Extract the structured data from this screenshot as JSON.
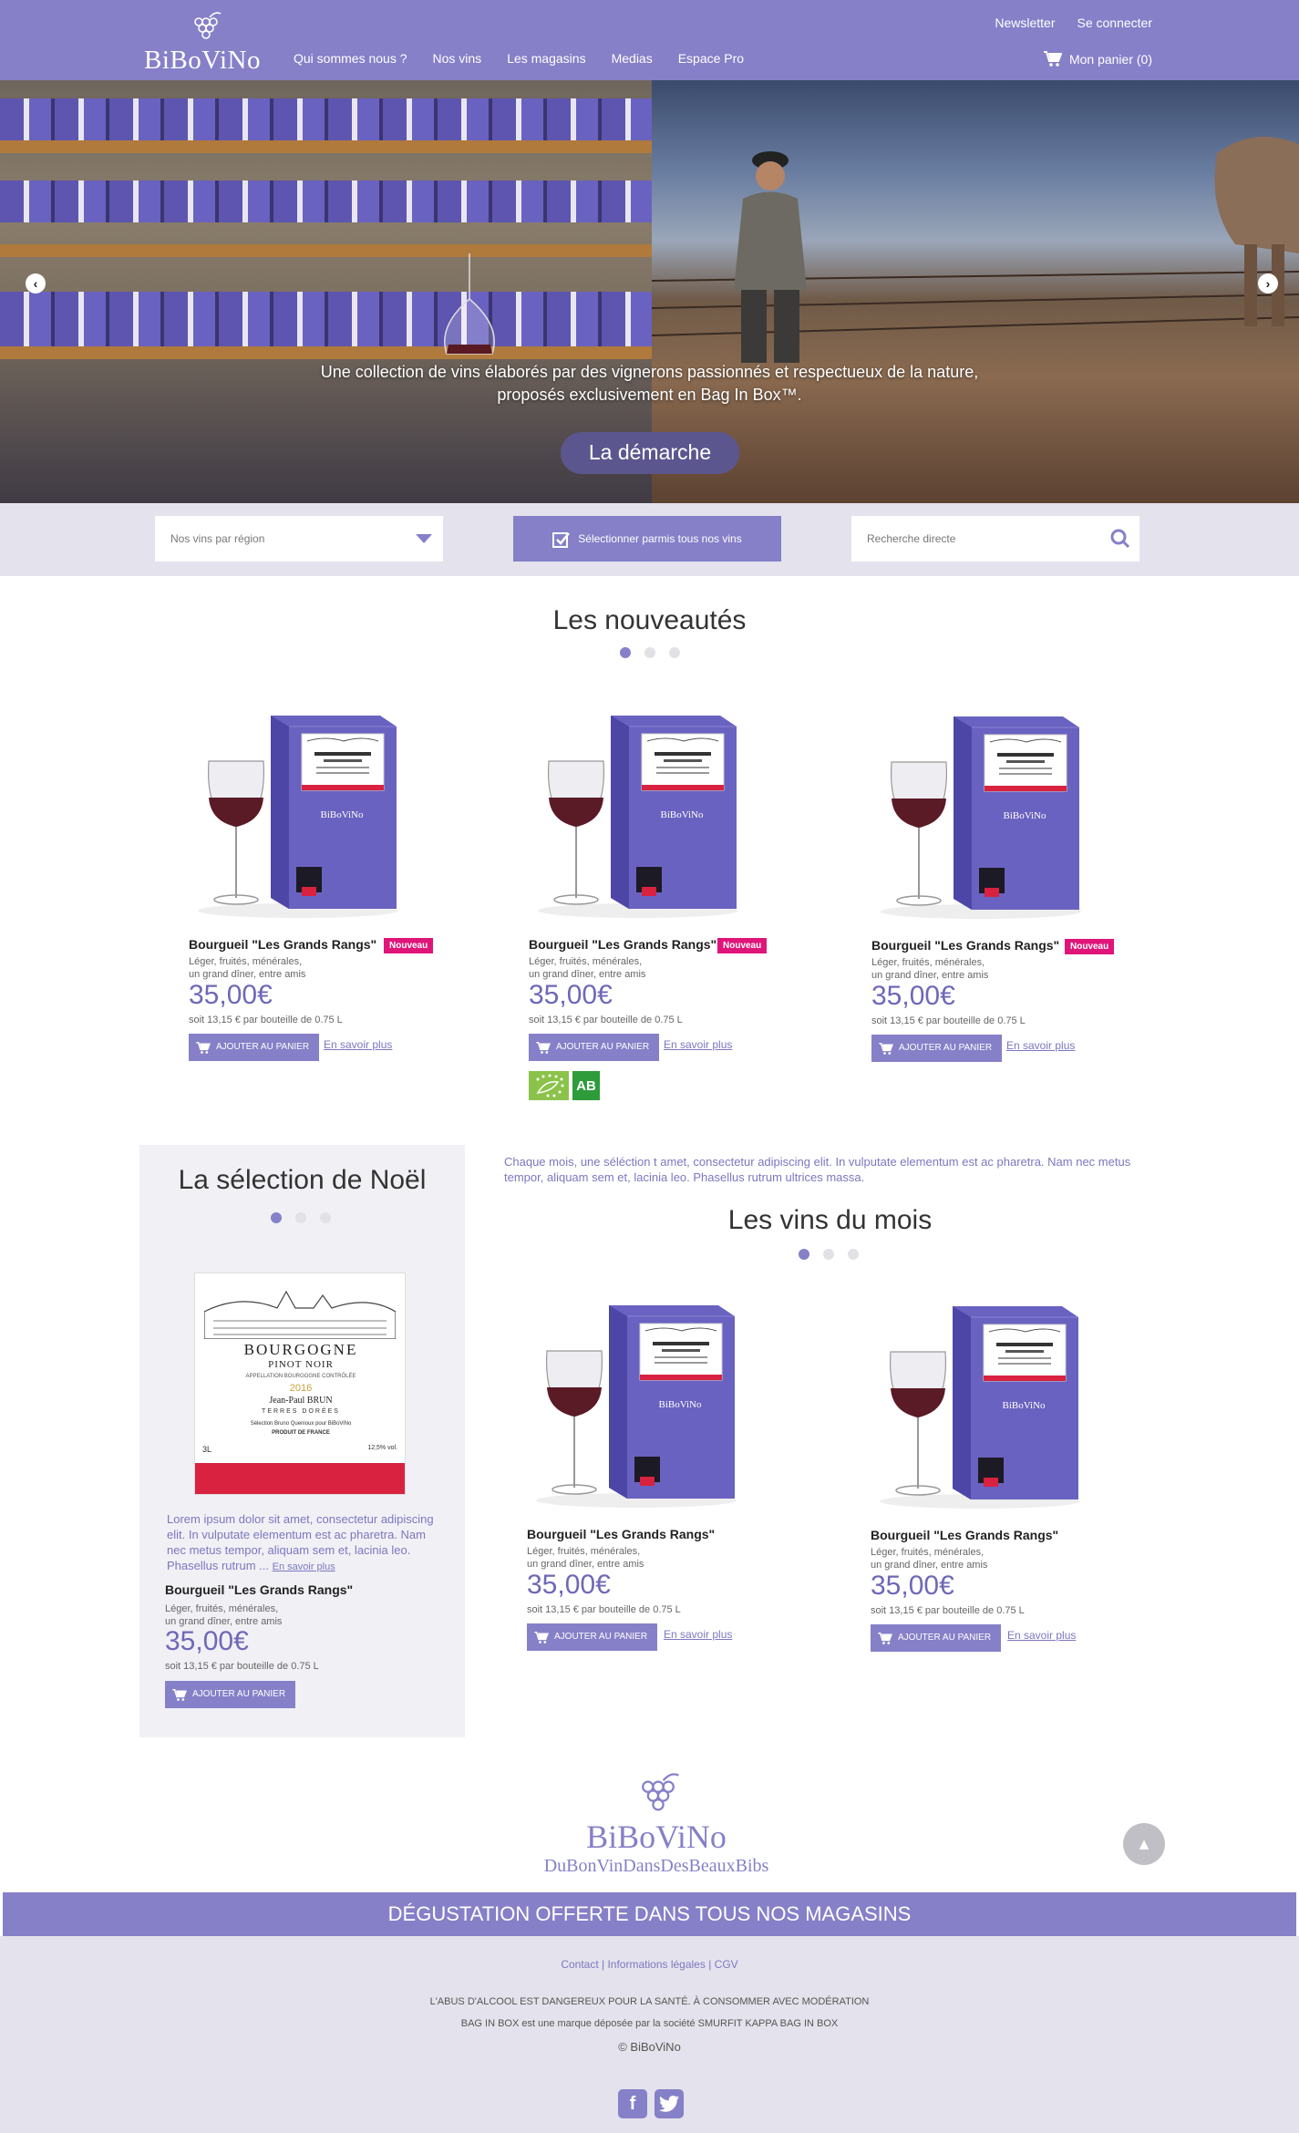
{
  "header": {
    "logo_text": "BiBoViNo",
    "nav": [
      "Qui sommes nous ?",
      "Nos vins",
      "Les magasins",
      "Medias",
      "Espace Pro"
    ],
    "newsletter": "Newsletter",
    "login": "Se connecter",
    "cart": "Mon panier (0)"
  },
  "hero": {
    "line1": "Une collection de vins élaborés par des vignerons passionnés et respectueux de la nature,",
    "line2": "proposés exclusivement en Bag In Box™.",
    "button": "La démarche"
  },
  "filters": {
    "region_placeholder": "Nos vins par région",
    "select_all": "Sélectionner parmis tous nos vins",
    "search_placeholder": "Recherche directe"
  },
  "nouveautes": {
    "title": "Les nouveautés",
    "products": [
      {
        "name": "Bourgueil \"Les Grands Rangs\"",
        "badge": "Nouveau",
        "desc1": "Léger, fruités, ménérales,",
        "desc2": "un grand dîner, entre amis",
        "price": "35,00€",
        "unit": "soit 13,15 € par bouteille de 0.75 L",
        "add": "AJOUTER AU PANIER",
        "more": "En savoir plus"
      },
      {
        "name": "Bourgueil \"Les Grands Rangs\"",
        "badge": "Nouveau",
        "desc1": "Léger, fruités, ménérales,",
        "desc2": "un grand dîner, entre amis",
        "price": "35,00€",
        "unit": "soit 13,15 € par bouteille de 0.75 L",
        "add": "AJOUTER AU PANIER",
        "more": "En savoir plus"
      },
      {
        "name": "Bourgueil \"Les Grands Rangs\"",
        "badge": "Nouveau",
        "desc1": "Léger, fruités, ménérales,",
        "desc2": "un grand dîner, entre amis",
        "price": "35,00€",
        "unit": "soit 13,15 € par bouteille de 0.75 L",
        "add": "AJOUTER AU PANIER",
        "more": "En savoir plus"
      }
    ],
    "bio_label": "AB"
  },
  "box_label": "BiBoViNo",
  "noel": {
    "title": "La sélection de Noël",
    "label": {
      "region": "BOURGOGNE",
      "type": "PINOT NOIR",
      "appellation": "APPELLATION BOURGOGNE CONTRÔLÉE",
      "year": "2016",
      "producer": "Jean-Paul BRUN",
      "domain": "TERRES DORÉES",
      "selection": "Sélection Bruno Quenioux pour BiBoViNo",
      "origin": "PRODUIT DE FRANCE",
      "volume": "3L",
      "alcohol": "12,5% vol."
    },
    "text": "Lorem ipsum dolor sit amet, consectetur adipiscing elit. In vulputate elementum est ac pharetra. Nam nec metus tempor, aliquam sem et, lacinia leo. Phasellus rutrum ...",
    "more": "En savoir plus",
    "product": {
      "name": "Bourgueil \"Les Grands Rangs\"",
      "desc1": "Léger, fruités, ménérales,",
      "desc2": "un grand dîner, entre amis",
      "price": "35,00€",
      "unit": "soit 13,15 € par bouteille de 0.75 L",
      "add": "AJOUTER AU PANIER"
    }
  },
  "mois": {
    "intro": "Chaque mois, une séléction t amet, consectetur adipiscing elit. In vulputate elementum est ac pharetra. Nam nec metus tempor, aliquam sem et, lacinia leo. Phasellus rutrum ultrices massa.",
    "title": "Les vins du mois",
    "products": [
      {
        "name": "Bourgueil \"Les Grands Rangs\"",
        "desc1": "Léger, fruités, ménérales,",
        "desc2": "un grand dîner, entre amis",
        "price": "35,00€",
        "unit": "soit 13,15 € par bouteille de 0.75 L",
        "add": "AJOUTER AU PANIER",
        "more": "En savoir plus"
      },
      {
        "name": "Bourgueil \"Les Grands Rangs\"",
        "desc1": "Léger, fruités, ménérales,",
        "desc2": "un grand dîner, entre amis",
        "price": "35,00€",
        "unit": "soit 13,15 € par bouteille de 0.75 L",
        "add": "AJOUTER AU PANIER",
        "more": "En savoir plus"
      }
    ]
  },
  "footer": {
    "logo_text": "BiBoViNo",
    "tagline": "DuBonVinDansDesBeauxBibs",
    "banner": "DÉGUSTATION OFFERTE DANS TOUS NOS MAGASINS",
    "links": [
      "Contact",
      "Informations légales",
      "CGV"
    ],
    "warning": "L'ABUS D'ALCOOL EST DANGEREUX POUR LA SANTÉ. À CONSOMMER AVEC MODÉRATION",
    "trademark": "BAG IN BOX est une marque déposée par la société SMURFIT KAPPA BAG IN BOX",
    "copyright": "© BiBoViNo"
  },
  "colors": {
    "accent": "#8580c8",
    "badge": "#e0157a",
    "price": "#6e68b8"
  }
}
